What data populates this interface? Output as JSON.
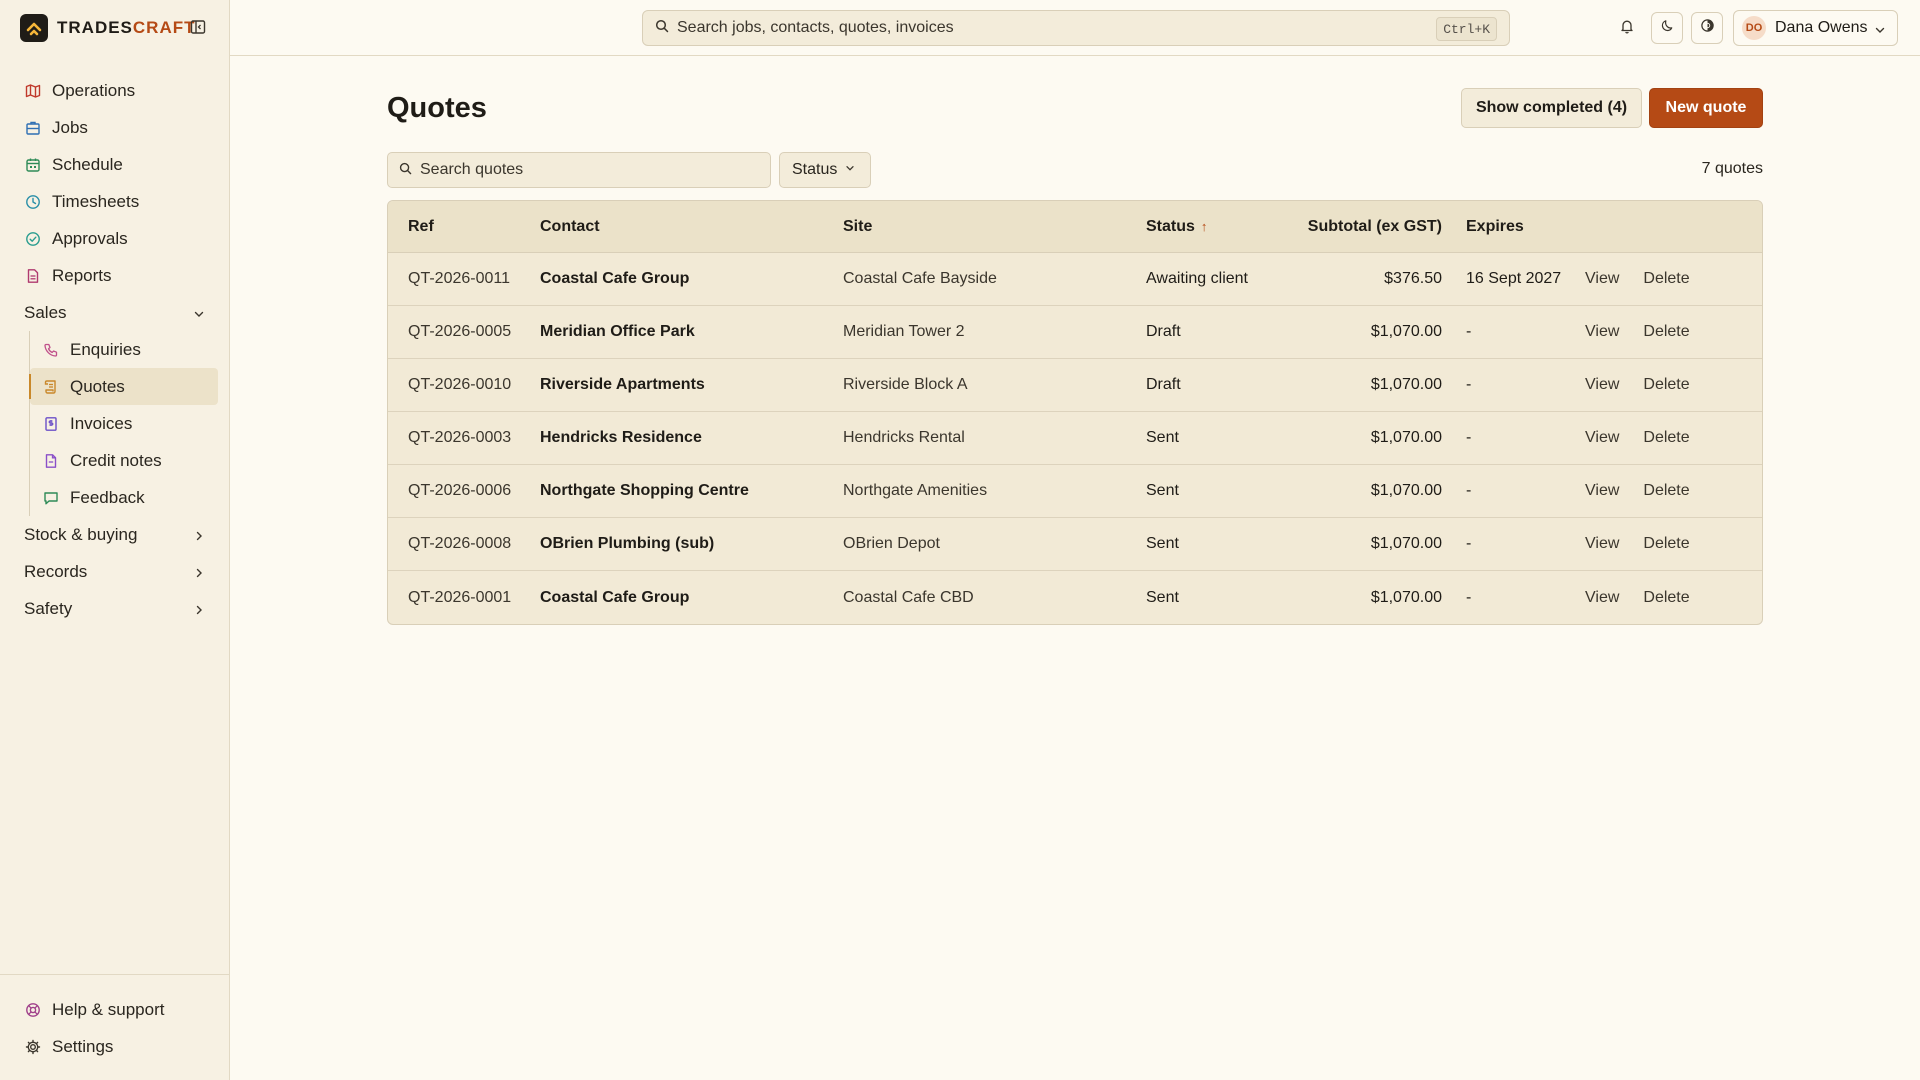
{
  "brand": {
    "name_part1": "TRADES",
    "name_part2": "CRAFT"
  },
  "sidebar": {
    "items": [
      {
        "label": "Operations",
        "icon": "map-icon",
        "color": "#c0392b"
      },
      {
        "label": "Jobs",
        "icon": "building-icon",
        "color": "#2f6fb3"
      },
      {
        "label": "Schedule",
        "icon": "calendar-icon",
        "color": "#2e8b57"
      },
      {
        "label": "Timesheets",
        "icon": "clock-icon",
        "color": "#2a8fa8"
      },
      {
        "label": "Approvals",
        "icon": "check-circle-icon",
        "color": "#2a9d8f"
      },
      {
        "label": "Reports",
        "icon": "file-icon",
        "color": "#b03a6f"
      }
    ],
    "sales_group": {
      "label": "Sales",
      "items": [
        {
          "label": "Enquiries",
          "icon": "phone-icon",
          "color": "#c0508a"
        },
        {
          "label": "Quotes",
          "icon": "scroll-icon",
          "color": "#c9882a",
          "active": true
        },
        {
          "label": "Invoices",
          "icon": "receipt-icon",
          "color": "#6b4fc8"
        },
        {
          "label": "Credit notes",
          "icon": "document-icon",
          "color": "#8a4fc8"
        },
        {
          "label": "Feedback",
          "icon": "message-icon",
          "color": "#2e8b57"
        }
      ]
    },
    "groups": [
      {
        "label": "Stock & buying"
      },
      {
        "label": "Records"
      },
      {
        "label": "Safety"
      }
    ],
    "bottom": [
      {
        "label": "Help & support",
        "icon": "lifebuoy-icon",
        "color": "#a0408a"
      },
      {
        "label": "Settings",
        "icon": "gear-icon",
        "color": "#3b362d"
      }
    ]
  },
  "topbar": {
    "search_placeholder": "Search jobs, contacts, quotes, invoices",
    "shortcut": "Ctrl+K",
    "user": {
      "initials": "DO",
      "name": "Dana Owens"
    }
  },
  "page": {
    "title": "Quotes",
    "show_completed_label": "Show completed (4)",
    "new_quote_label": "New quote",
    "search_placeholder": "Search quotes",
    "status_filter_label": "Status",
    "count_label": "7 quotes"
  },
  "table": {
    "columns": {
      "ref": "Ref",
      "contact": "Contact",
      "site": "Site",
      "status": "Status",
      "subtotal": "Subtotal (ex GST)",
      "expires": "Expires"
    },
    "view_label": "View",
    "delete_label": "Delete",
    "rows": [
      {
        "ref": "QT-2026-0011",
        "contact": "Coastal Cafe Group",
        "site": "Coastal Cafe Bayside",
        "status": "Awaiting client",
        "subtotal": "$376.50",
        "expires": "16 Sept 2027"
      },
      {
        "ref": "QT-2026-0005",
        "contact": "Meridian Office Park",
        "site": "Meridian Tower 2",
        "status": "Draft",
        "subtotal": "$1,070.00",
        "expires": "-"
      },
      {
        "ref": "QT-2026-0010",
        "contact": "Riverside Apartments",
        "site": "Riverside Block A",
        "status": "Draft",
        "subtotal": "$1,070.00",
        "expires": "-"
      },
      {
        "ref": "QT-2026-0003",
        "contact": "Hendricks Residence",
        "site": "Hendricks Rental",
        "status": "Sent",
        "subtotal": "$1,070.00",
        "expires": "-"
      },
      {
        "ref": "QT-2026-0006",
        "contact": "Northgate Shopping Centre",
        "site": "Northgate Amenities",
        "status": "Sent",
        "subtotal": "$1,070.00",
        "expires": "-"
      },
      {
        "ref": "QT-2026-0008",
        "contact": "OBrien Plumbing (sub)",
        "site": "OBrien Depot",
        "status": "Sent",
        "subtotal": "$1,070.00",
        "expires": "-"
      },
      {
        "ref": "QT-2026-0001",
        "contact": "Coastal Cafe Group",
        "site": "Coastal Cafe CBD",
        "status": "Sent",
        "subtotal": "$1,070.00",
        "expires": "-"
      }
    ]
  },
  "colors": {
    "accent": "#b54a15",
    "background": "#fdfaf2",
    "sidebar": "#f7f1e3"
  }
}
